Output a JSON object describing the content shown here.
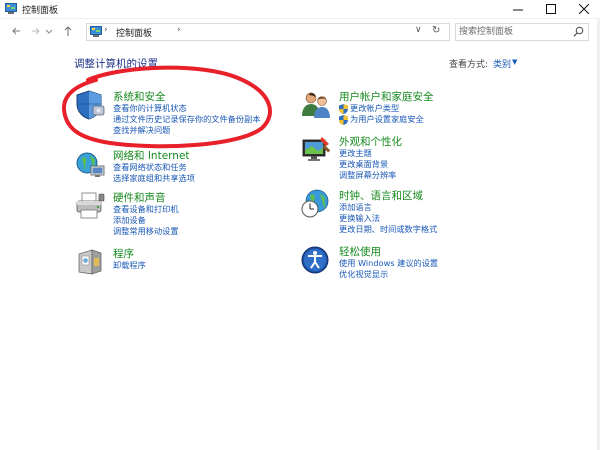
{
  "window": {
    "title": "控制面板"
  },
  "address": {
    "crumb": "控制面板",
    "separator": "›",
    "search_placeholder": "搜索控制面板"
  },
  "content": {
    "heading": "调整计算机的设置",
    "view_by_label": "查看方式:",
    "view_by_value": "类别"
  },
  "categories": {
    "system_security": {
      "title": "系统和安全",
      "links": [
        "查看你的计算机状态",
        "通过文件历史记录保存你的文件备份副本",
        "查找并解决问题"
      ]
    },
    "network": {
      "title": "网络和 Internet",
      "links": [
        "查看网络状态和任务",
        "选择家庭组和共享选项"
      ]
    },
    "hardware": {
      "title": "硬件和声音",
      "links": [
        "查看设备和打印机",
        "添加设备",
        "调整常用移动设置"
      ]
    },
    "programs": {
      "title": "程序",
      "links": [
        "卸载程序"
      ]
    },
    "user_accounts": {
      "title": "用户帐户和家庭安全",
      "links": [
        "更改帐户类型",
        "为用户设置家庭安全"
      ]
    },
    "appearance": {
      "title": "外观和个性化",
      "links": [
        "更改主题",
        "更改桌面背景",
        "调整屏幕分辨率"
      ]
    },
    "clock": {
      "title": "时钟、语言和区域",
      "links": [
        "添加语言",
        "更换输入法",
        "更改日期、时间或数字格式"
      ]
    },
    "ease": {
      "title": "轻松使用",
      "links": [
        "使用 Windows 建议的设置",
        "优化视觉显示"
      ]
    }
  },
  "colors": {
    "category_title": "#178a1f",
    "link": "#1a58b6",
    "heading": "#1e3287",
    "annotation": "#e8202a"
  },
  "icons": {
    "system_security": "shield-icon",
    "network": "network-globe-icon",
    "hardware": "printer-icon",
    "programs": "programs-icon",
    "user_accounts": "users-icon",
    "appearance": "monitor-paint-icon",
    "clock": "clock-globe-icon",
    "ease": "ease-of-access-icon"
  }
}
